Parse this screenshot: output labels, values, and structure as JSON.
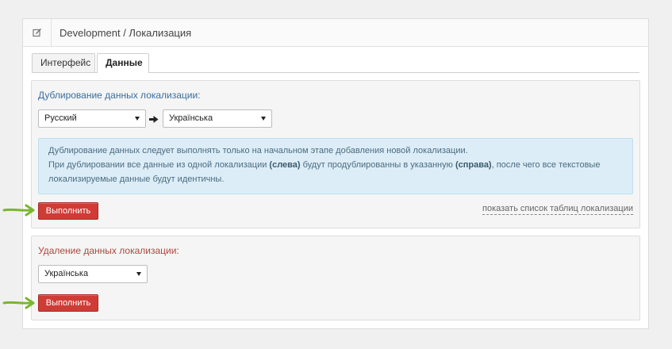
{
  "header": {
    "icon": "edit-icon",
    "title": "Development / Локализация"
  },
  "tabs": [
    {
      "label": "Интерфейс",
      "active": false
    },
    {
      "label": "Данные",
      "active": true
    }
  ],
  "duplicate": {
    "title": "Дублирование данных локализации:",
    "source_select": "Русский",
    "arrow_icon": "arrow-right-icon",
    "target_select": "Українська",
    "info_line1": "Дублирование данных следует выполнять только на начальном этапе добавления новой локализации.",
    "info_line2_a": "При дублировании все данные из одной локализации ",
    "info_left": "(слева)",
    "info_line2_b": " будут продублированны в указанную ",
    "info_right": "(справа)",
    "info_line2_c": ", после чего все текстовые",
    "info_line3": "локализируемые данные будут идентичны.",
    "execute_label": "Выполнить",
    "show_tables_link": "показать список таблиц локализации"
  },
  "delete": {
    "title": "Удаление данных локализации:",
    "select": "Українська",
    "execute_label": "Выполнить"
  },
  "colors": {
    "accent_red": "#cf3c36",
    "info_bg": "#dcedf7",
    "annotation_arrow": "#7ab62f"
  }
}
